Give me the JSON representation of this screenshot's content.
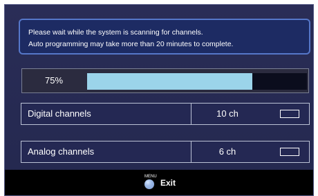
{
  "message": {
    "line1": "Please wait while the system is scanning for channels.",
    "line2": "Auto programming may take more than 20 minutes to complete."
  },
  "progress": {
    "label": "75%",
    "value": 0.75,
    "fill_color": "#9bd4ea"
  },
  "channels": [
    {
      "label": "Digital channels",
      "count": "10 ch"
    },
    {
      "label": "Analog channels",
      "count": "6 ch"
    }
  ],
  "footer": {
    "key_label": "MENU",
    "action_label": "Exit"
  },
  "icons": {
    "menu_key": "circle-button-icon",
    "status_indicator": "rectangle-indicator-icon"
  },
  "colors": {
    "screen_background": "#272b54",
    "message_background": "#1d2b63",
    "message_border": "#5677c9",
    "footer_background": "#000000",
    "text": "#ffffff"
  }
}
